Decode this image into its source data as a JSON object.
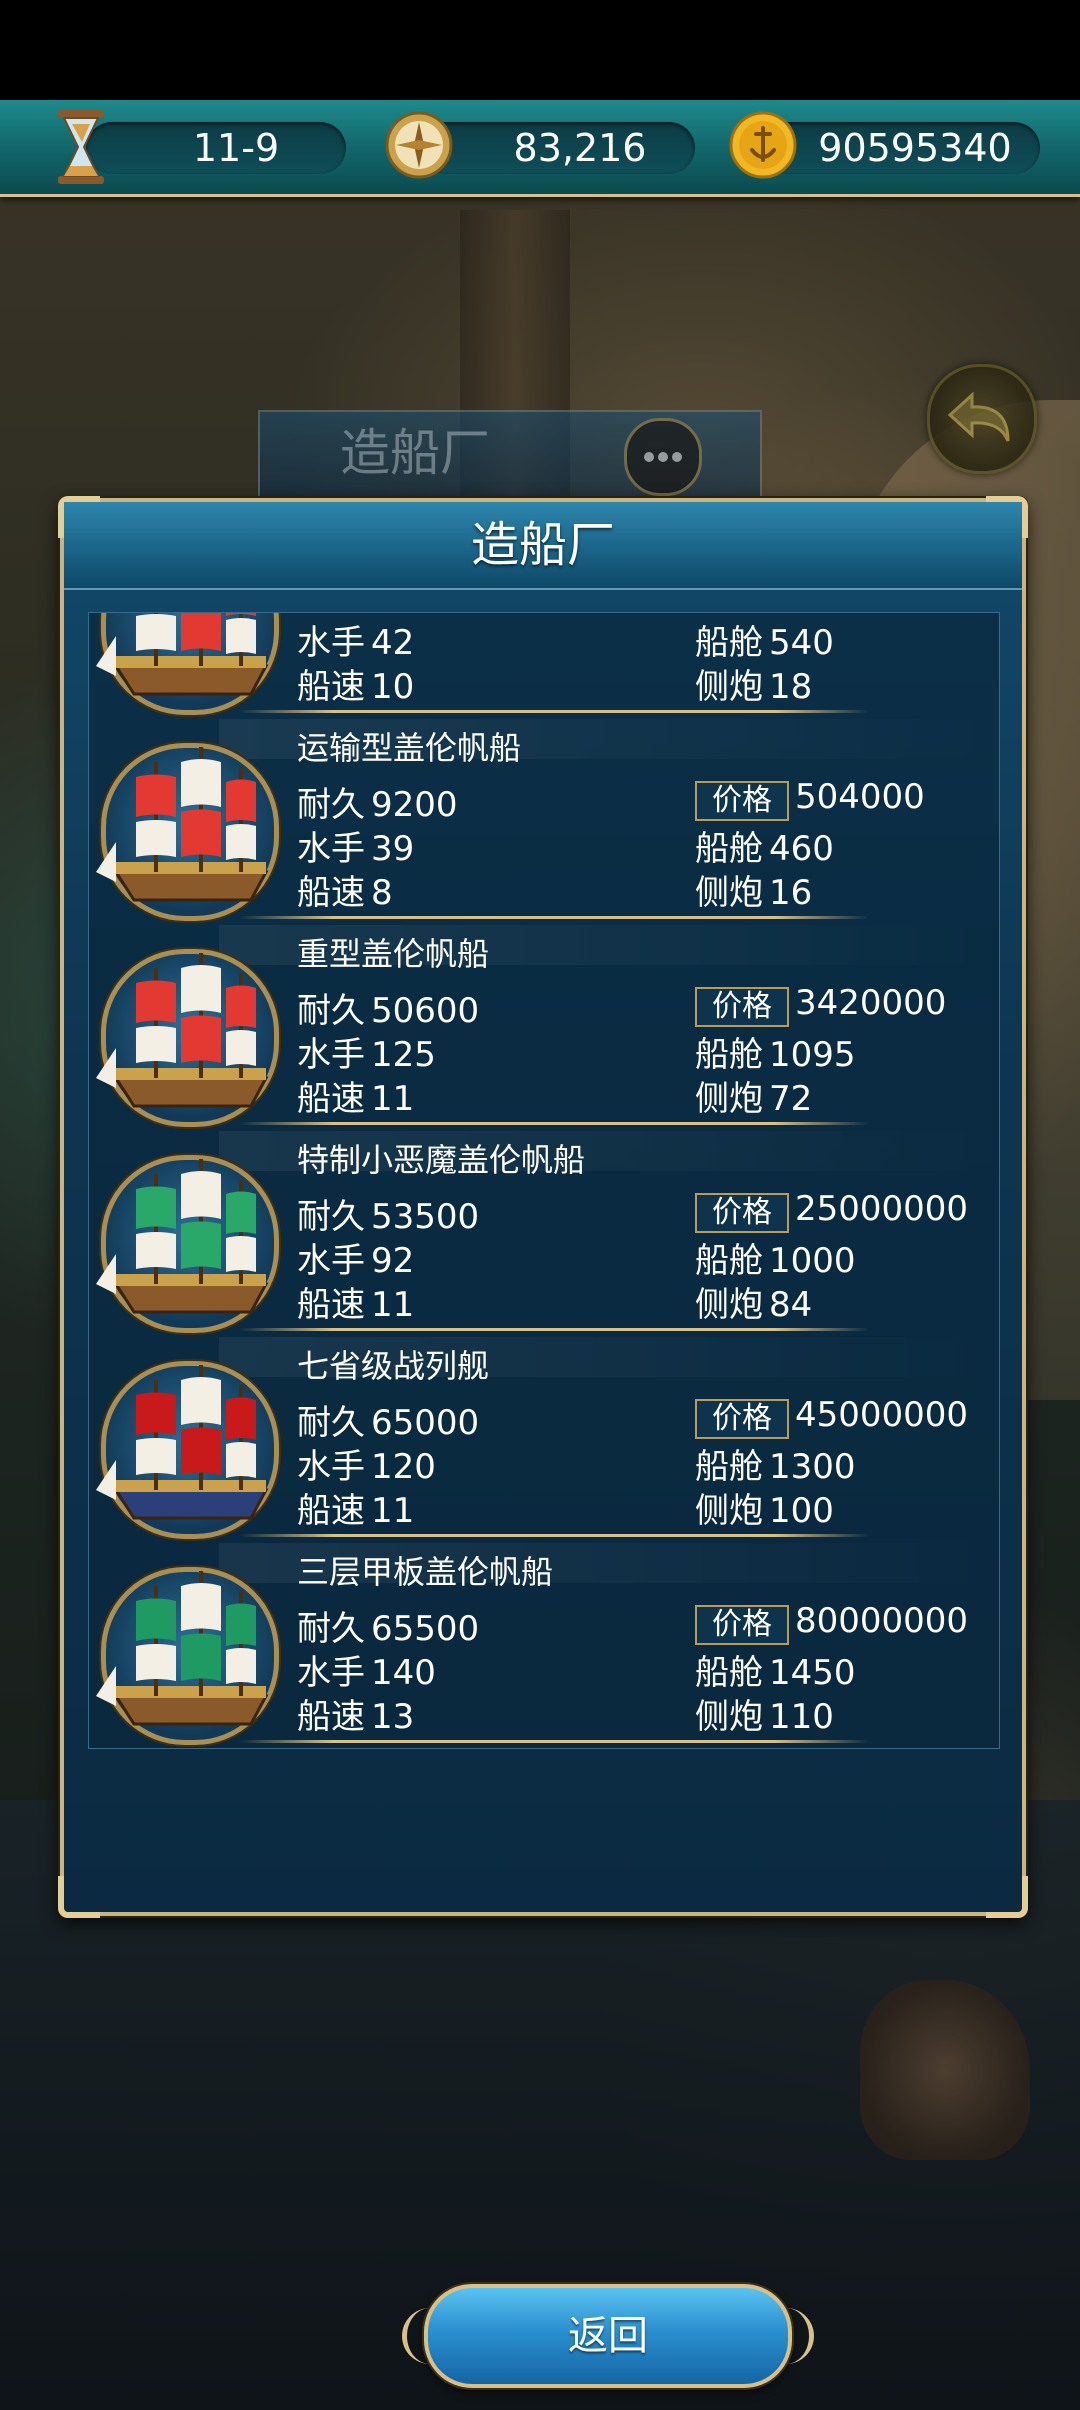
{
  "resources": [
    {
      "icon": "hourglass-icon",
      "value": "11-9"
    },
    {
      "icon": "compass-icon",
      "value": "83,216"
    },
    {
      "icon": "gold-coin-icon",
      "value": "90595340"
    }
  ],
  "background": {
    "banner_title": "造船厂",
    "chat_icon": "chat-bubble-icon",
    "back_icon": "return-arrow-icon"
  },
  "dialog": {
    "title": "造船厂",
    "return_label": "返回",
    "labels": {
      "durability": "耐久",
      "sailors": "水手",
      "speed": "船速",
      "price": "价格",
      "cabin": "船舱",
      "cannons": "侧炮"
    },
    "ships": [
      {
        "name": "",
        "durability": "",
        "price": "",
        "sailors": "42",
        "cabin": "540",
        "speed": "10",
        "cannons": "18",
        "sail_color": "#e23a32"
      },
      {
        "name": "运输型盖伦帆船",
        "durability": "9200",
        "price": "504000",
        "sailors": "39",
        "cabin": "460",
        "speed": "8",
        "cannons": "16",
        "sail_color": "#e23a32"
      },
      {
        "name": "重型盖伦帆船",
        "durability": "50600",
        "price": "3420000",
        "sailors": "125",
        "cabin": "1095",
        "speed": "11",
        "cannons": "72",
        "sail_color": "#e23a32"
      },
      {
        "name": "特制小恶魔盖伦帆船",
        "durability": "53500",
        "price": "25000000",
        "sailors": "92",
        "cabin": "1000",
        "speed": "11",
        "cannons": "84",
        "sail_color": "#2aa86a"
      },
      {
        "name": "七省级战列舰",
        "durability": "65000",
        "price": "45000000",
        "sailors": "120",
        "cabin": "1300",
        "speed": "11",
        "cannons": "100",
        "sail_color": "#c8191b"
      },
      {
        "name": "三层甲板盖伦帆船",
        "durability": "65500",
        "price": "80000000",
        "sailors": "140",
        "cabin": "1450",
        "speed": "13",
        "cannons": "110",
        "sail_color": "#1f9a63"
      }
    ]
  }
}
